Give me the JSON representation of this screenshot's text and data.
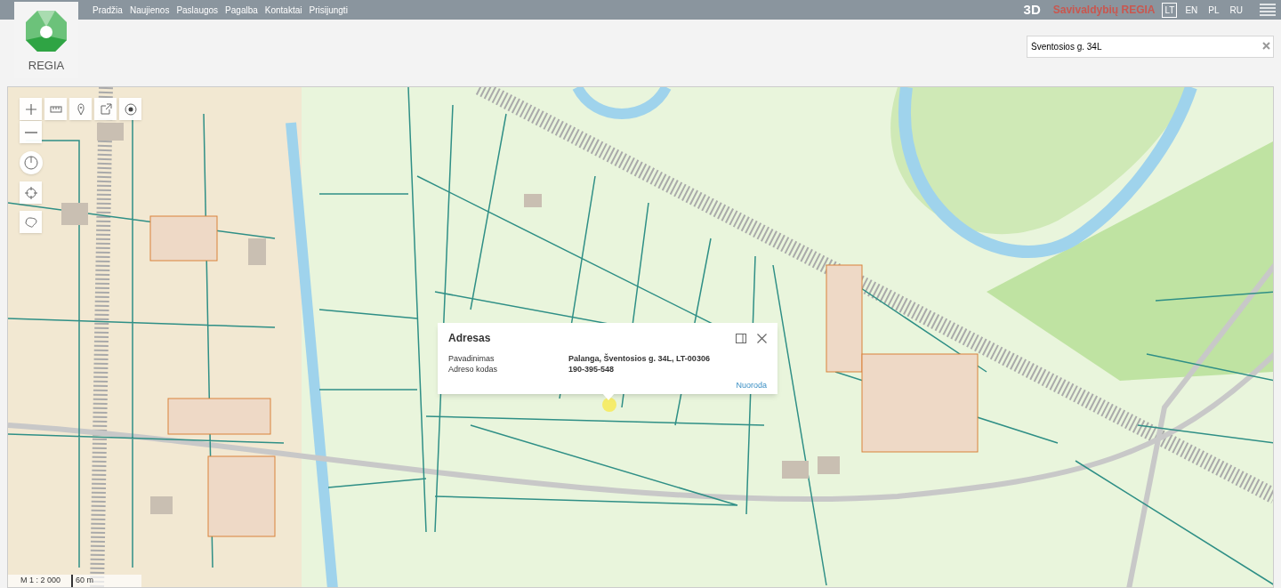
{
  "nav": {
    "links": [
      "Pradžia",
      "Naujienos",
      "Paslaugos",
      "Pagalba",
      "Kontaktai",
      "Prisijungti"
    ]
  },
  "logo": {
    "text": "REGIA"
  },
  "top_right": {
    "mode": "3D",
    "brand": "Savivaldybių REGIA",
    "languages": [
      {
        "label": "LT",
        "selected": true
      },
      {
        "label": "EN",
        "selected": false
      },
      {
        "label": "PL",
        "selected": false
      },
      {
        "label": "RU",
        "selected": false
      }
    ]
  },
  "search": {
    "value": "Šventosios g. 34L"
  },
  "map_tools": [
    {
      "kind": "zoom-in"
    },
    {
      "kind": "zoom-out"
    },
    {
      "kind": "measure"
    },
    {
      "kind": "pin"
    },
    {
      "kind": "share"
    },
    {
      "kind": "locate"
    },
    {
      "kind": "compass"
    },
    {
      "kind": "crosshair"
    },
    {
      "kind": "region"
    }
  ],
  "popup": {
    "title": "Adresas",
    "rows": [
      {
        "label": "Pavadinimas",
        "value": "Palanga, Šventosios g. 34L, LT-00306"
      },
      {
        "label": "Adreso kodas",
        "value": "190-395-548"
      }
    ],
    "link": "Nuoroda"
  },
  "scale": {
    "ratio": "M 1 : 2 000",
    "distance": "60 m"
  }
}
